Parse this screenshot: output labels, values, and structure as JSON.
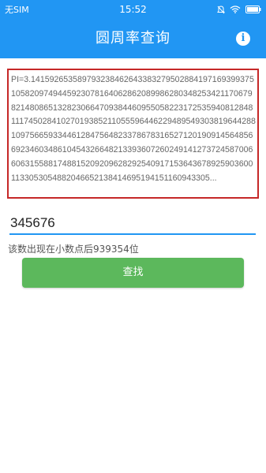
{
  "status_bar": {
    "carrier": "无SIM",
    "time": "15:52"
  },
  "app_bar": {
    "title": "圆周率查询",
    "info_label": "i"
  },
  "pi_display": {
    "text": "PI=3.14159265358979323846264338327950288419716939937510582097494459230781640628620899862803482534211706798214808651328230664709384460955058223172535940812848111745028410270193852110555964462294895493038196442881097566593344612847564823378678316527120190914564856692346034861045432664821339360726024914127372458700660631558817488152092096282925409171536436789259036001133053054882046652138414695194151160943305..."
  },
  "search": {
    "value": "345676"
  },
  "result": {
    "text": "该数出现在小数点后939354位"
  },
  "find_button": {
    "label": "查找"
  },
  "colors": {
    "primary": "#2196f3",
    "button": "#5cb85c",
    "border": "#c62828"
  },
  "icons": [
    "no-sim",
    "mute-icon",
    "wifi-icon",
    "battery-icon",
    "info-icon"
  ]
}
